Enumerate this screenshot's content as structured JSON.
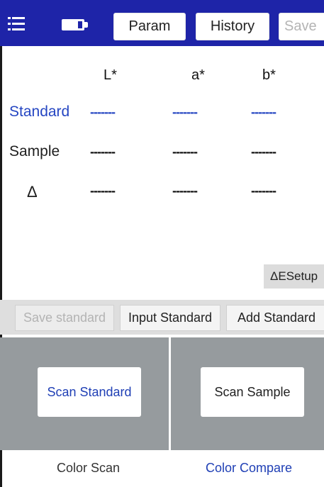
{
  "header": {
    "param_label": "Param",
    "history_label": "History",
    "save_label": "Save",
    "bg_color": "#1e24a8"
  },
  "table": {
    "columns": [
      "L*",
      "a*",
      "b*"
    ],
    "rows": [
      {
        "label": "Standard",
        "values": [
          "-------",
          "-------",
          "-------"
        ],
        "color": "#2546c2"
      },
      {
        "label": "Sample",
        "values": [
          "-------",
          "-------",
          "-------"
        ]
      },
      {
        "label": "Δ",
        "values": [
          "-------",
          "-------",
          "-------"
        ]
      }
    ]
  },
  "esetup_label": "ΔESetup",
  "actions": {
    "save_standard": "Save standard",
    "input_standard": "Input Standard",
    "add_standard": "Add Standard"
  },
  "scan": {
    "scan_standard": "Scan Standard",
    "scan_sample": "Scan Sample",
    "panel_color": "#969b9e"
  },
  "tabs": {
    "color_scan": "Color Scan",
    "color_compare": "Color Compare",
    "active_color": "#1f3fb5"
  },
  "icons": {
    "menu": "menu-icon",
    "battery": "battery-icon"
  }
}
